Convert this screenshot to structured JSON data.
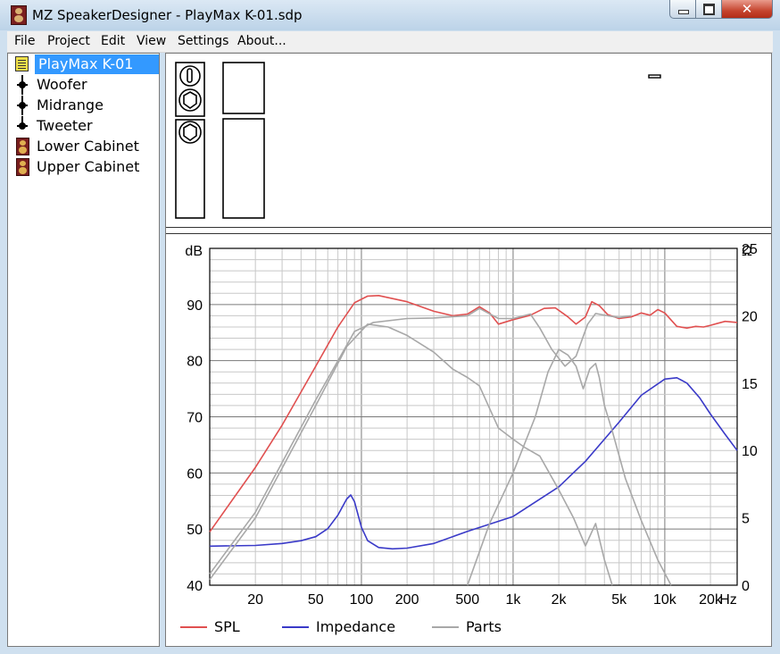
{
  "window": {
    "title": "MZ SpeakerDesigner - PlayMax K-01.sdp",
    "close_glyph": "✕"
  },
  "menu": {
    "items": [
      "File",
      "Project",
      "Edit",
      "View",
      "Settings",
      "About..."
    ]
  },
  "tree": {
    "project": "PlayMax K-01",
    "drivers": [
      "Woofer",
      "Midrange",
      "Tweeter"
    ],
    "cabinets": [
      "Lower Cabinet",
      "Upper Cabinet"
    ]
  },
  "colors": {
    "spl": "#e05050",
    "impedance": "#3a3ac8",
    "parts": "#a8a8a8",
    "selection": "#3399ff",
    "grid_major": "#7a7a7a",
    "grid_minor": "#c8c8c8"
  },
  "chart_data": {
    "type": "line",
    "x_scale": "log",
    "xlim": [
      10,
      30000
    ],
    "ylim_left": [
      40,
      100
    ],
    "ylim_right": [
      0,
      25
    ],
    "left_unit": "dB",
    "right_unit": "Ω",
    "x_unit": "Hz",
    "x_tick_values": [
      20,
      50,
      100,
      200,
      500,
      1000,
      2000,
      5000,
      10000,
      20000
    ],
    "x_tick_labels": [
      "20",
      "50",
      "100",
      "200",
      "500",
      "1k",
      "2k",
      "5k",
      "10k",
      "20k"
    ],
    "y_left_ticks": [
      40,
      50,
      60,
      70,
      80,
      90
    ],
    "y_right_ticks": [
      0,
      5,
      10,
      15,
      20,
      25
    ],
    "grid": true,
    "legend_position": "bottom",
    "series": [
      {
        "name": "SPL",
        "axis": "left",
        "color": "#e05050",
        "x": [
          10,
          20,
          30,
          50,
          70,
          90,
          110,
          130,
          200,
          300,
          400,
          500,
          600,
          700,
          800,
          1000,
          1300,
          1600,
          1900,
          2300,
          2600,
          3000,
          3300,
          3700,
          4200,
          5000,
          6000,
          7000,
          8000,
          9000,
          10000,
          12000,
          14000,
          16000,
          18000,
          20000,
          22000,
          25000,
          30000
        ],
        "y": [
          49.5,
          61,
          68.5,
          79,
          86,
          90.3,
          91.5,
          91.6,
          90.5,
          88.8,
          88,
          88.3,
          89.6,
          88.5,
          86.5,
          87.3,
          88.1,
          89.3,
          89.4,
          87.8,
          86.5,
          87.8,
          90.5,
          89.8,
          88.2,
          87.5,
          87.8,
          88.5,
          88.1,
          89.1,
          88.5,
          86.1,
          85.8,
          86.1,
          86.0,
          86.3,
          86.6,
          87.0,
          86.8
        ]
      },
      {
        "name": "Impedance",
        "axis": "right",
        "color": "#3a3ac8",
        "x": [
          10,
          20,
          30,
          40,
          50,
          60,
          70,
          80,
          85,
          90,
          100,
          110,
          130,
          160,
          200,
          300,
          500,
          1000,
          2000,
          3000,
          5000,
          7000,
          10000,
          12000,
          14000,
          17000,
          20000,
          25000,
          30000
        ],
        "y": [
          2.9,
          2.95,
          3.1,
          3.3,
          3.6,
          4.2,
          5.2,
          6.4,
          6.7,
          6.2,
          4.3,
          3.3,
          2.8,
          2.7,
          2.75,
          3.1,
          4,
          5.1,
          7.3,
          9.2,
          12.1,
          14.1,
          15.3,
          15.4,
          15,
          13.9,
          12.7,
          11.2,
          10
        ]
      },
      {
        "name": "Parts",
        "axis": "left",
        "color": "#a8a8a8",
        "x": [
          10,
          20,
          50,
          90,
          120,
          200,
          300,
          500,
          600,
          800,
          1000,
          1300,
          1500,
          1800,
          2200,
          2600,
          3100,
          3500,
          4200,
          5000,
          6000
        ],
        "y": [
          42,
          53,
          73,
          85.2,
          86.8,
          87.5,
          87.6,
          88,
          89.3,
          87.5,
          87.5,
          88.3,
          85.8,
          82,
          79,
          80.8,
          86.5,
          88.4,
          88,
          87.7,
          88
        ]
      },
      {
        "name": "Parts",
        "axis": "left",
        "color": "#a8a8a8",
        "x": [
          10,
          20,
          50,
          80,
          110,
          150,
          200,
          300,
          400,
          500,
          600,
          800,
          1000,
          1200,
          1500,
          2000,
          2500,
          3000,
          3500,
          4000,
          4500
        ],
        "y": [
          41,
          52,
          72,
          82.5,
          86.5,
          86,
          84.5,
          81.5,
          78.5,
          77,
          75.5,
          68,
          66,
          64.5,
          63,
          57,
          52,
          47,
          51,
          44.5,
          40
        ]
      },
      {
        "name": "Parts",
        "axis": "left",
        "color": "#a8a8a8",
        "x": [
          500,
          700,
          1000,
          1400,
          1700,
          2000,
          2300,
          2600,
          2900,
          3200,
          3500,
          3700,
          4000,
          4500,
          5500,
          7000,
          9000,
          11000
        ],
        "y": [
          40,
          51,
          60,
          70,
          78,
          82,
          81,
          79,
          75,
          78.5,
          79.5,
          77,
          72,
          67.5,
          59,
          51.5,
          44.5,
          40
        ]
      }
    ]
  }
}
